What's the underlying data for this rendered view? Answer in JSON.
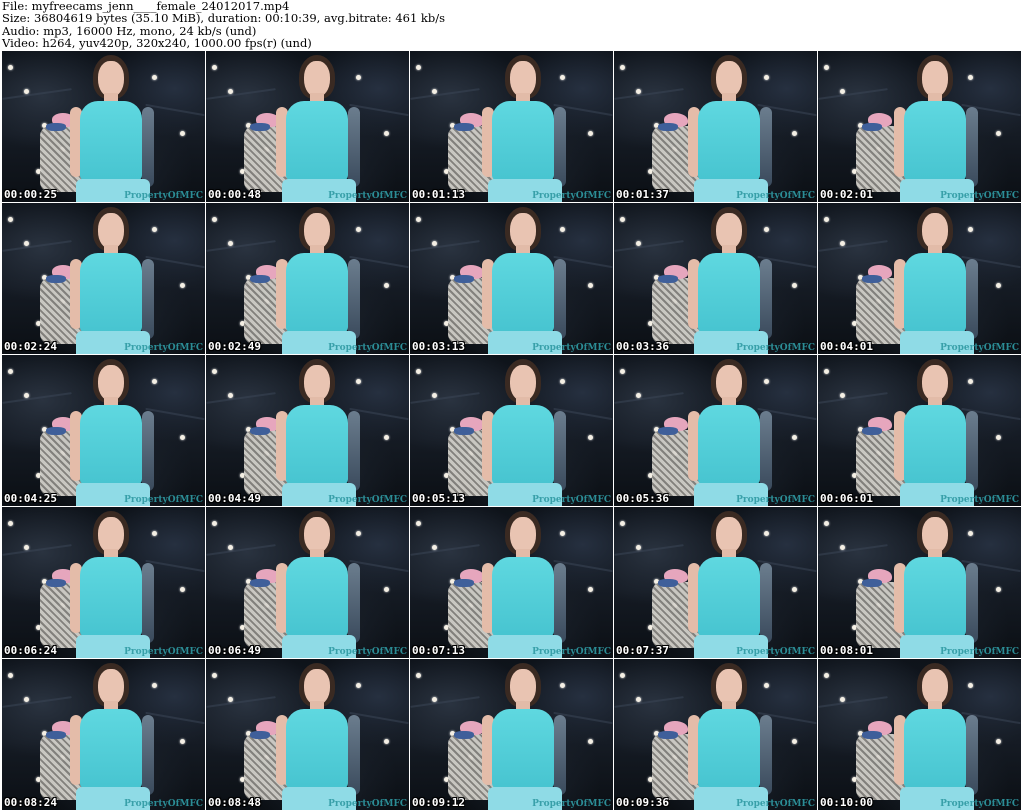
{
  "header": {
    "file_line": "File: myfreecams_jenn____female_24012017.mp4",
    "size_line": "Size: 36804619 bytes (35.10 MiB), duration: 00:10:39, avg.bitrate: 461 kb/s",
    "audio_line": "Audio: mp3, 16000 Hz, mono, 24 kb/s (und)",
    "video_line": "Video: h264, yuv420p, 320x240, 1000.00 fps(r) (und)"
  },
  "watermark": "PropertyOfMFC",
  "frames": [
    {
      "time": "00:00:25"
    },
    {
      "time": "00:00:48"
    },
    {
      "time": "00:01:13"
    },
    {
      "time": "00:01:37"
    },
    {
      "time": "00:02:01"
    },
    {
      "time": "00:02:24"
    },
    {
      "time": "00:02:49"
    },
    {
      "time": "00:03:13"
    },
    {
      "time": "00:03:36"
    },
    {
      "time": "00:04:01"
    },
    {
      "time": "00:04:25"
    },
    {
      "time": "00:04:49"
    },
    {
      "time": "00:05:13"
    },
    {
      "time": "00:05:36"
    },
    {
      "time": "00:06:01"
    },
    {
      "time": "00:06:24"
    },
    {
      "time": "00:06:49"
    },
    {
      "time": "00:07:13"
    },
    {
      "time": "00:07:37"
    },
    {
      "time": "00:08:01"
    },
    {
      "time": "00:08:24"
    },
    {
      "time": "00:08:48"
    },
    {
      "time": "00:09:12"
    },
    {
      "time": "00:09:36"
    },
    {
      "time": "00:10:00"
    }
  ]
}
